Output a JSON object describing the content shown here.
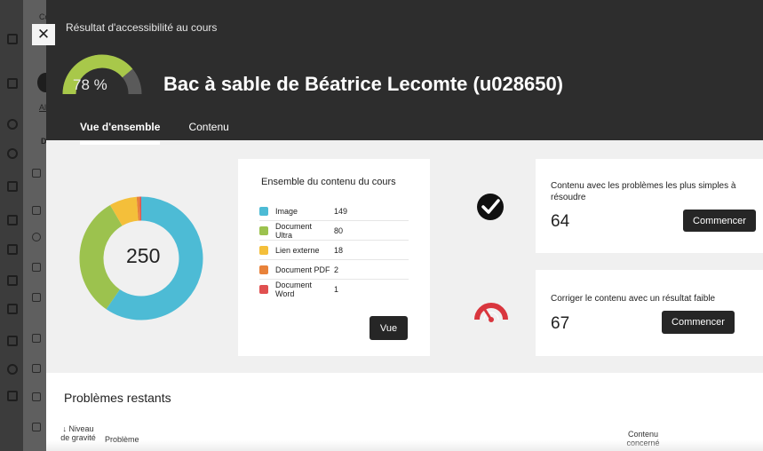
{
  "background": {
    "tiny_labels": [
      "Co",
      "Al",
      "D"
    ]
  },
  "close": {
    "glyph": "✕"
  },
  "header": {
    "eyebrow": "Résultat d'accessibilité au cours",
    "score_label": "78 %",
    "score": 78,
    "title": "Bac à sable de Béatrice Lecomte (u028650)",
    "tabs": [
      {
        "label": "Vue d'ensemble",
        "active": true
      },
      {
        "label": "Contenu",
        "active": false
      }
    ]
  },
  "overview": {
    "total": "250",
    "summary_title": "Ensemble du contenu du cours",
    "items": [
      {
        "label": "Image",
        "count": "149",
        "value": 149,
        "color": "#4dbbd5"
      },
      {
        "label": "Document Ultra",
        "count": "80",
        "value": 80,
        "color": "#9cc24e"
      },
      {
        "label": "Lien externe",
        "count": "18",
        "value": 18,
        "color": "#f4bf3a"
      },
      {
        "label": "Document PDF",
        "count": "2",
        "value": 2,
        "color": "#e8823a"
      },
      {
        "label": "Document Word",
        "count": "1",
        "value": 1,
        "color": "#e05050"
      }
    ],
    "view_button": "Vue"
  },
  "easy_issues": {
    "icon": "check-circle-icon",
    "text": "Contenu avec les problèmes les plus simples à résoudre",
    "count": "64",
    "button": "Commencer"
  },
  "low_score": {
    "icon": "speedometer-icon",
    "text": "Corriger le contenu avec un résultat faible",
    "count": "67",
    "button": "Commencer"
  },
  "remaining": {
    "title": "Problèmes restants",
    "col_severity": "↓ Niveau de gravité",
    "col_problem": "Problème",
    "col_content": "Contenu concerné"
  },
  "colors": {
    "header_bg": "#2d2d2d",
    "gauge_fill": "#a8c84a",
    "gauge_track": "#5a5a5a",
    "speed_icon": "#d9363e"
  }
}
